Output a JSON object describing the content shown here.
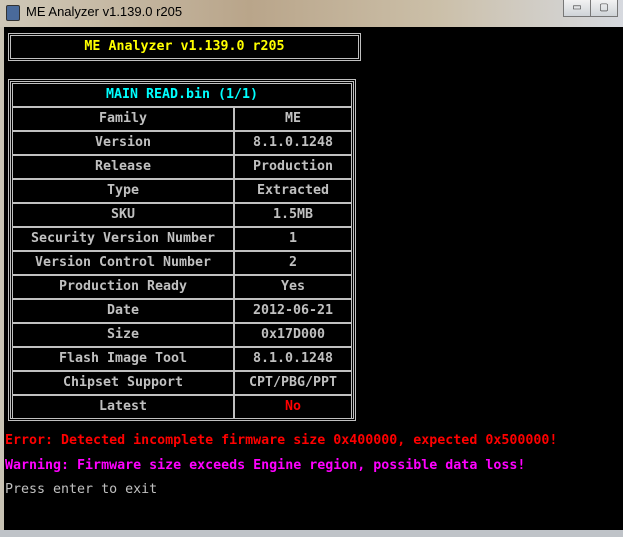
{
  "window": {
    "title": "ME Analyzer v1.139.0 r205",
    "minimize": "▭",
    "maximize": "▢"
  },
  "banner": "ME Analyzer v1.139.0 r205",
  "table": {
    "header": "MAIN  READ.bin (1/1)",
    "rows": [
      {
        "label": "Family",
        "value": "ME"
      },
      {
        "label": "Version",
        "value": "8.1.0.1248"
      },
      {
        "label": "Release",
        "value": "Production"
      },
      {
        "label": "Type",
        "value": "Extracted"
      },
      {
        "label": "SKU",
        "value": "1.5MB"
      },
      {
        "label": "Security Version Number",
        "value": "1"
      },
      {
        "label": "Version Control Number",
        "value": "2"
      },
      {
        "label": "Production Ready",
        "value": "Yes"
      },
      {
        "label": "Date",
        "value": "2012-06-21"
      },
      {
        "label": "Size",
        "value": "0x17D000"
      },
      {
        "label": "Flash Image Tool",
        "value": "8.1.0.1248"
      },
      {
        "label": "Chipset Support",
        "value": "CPT/PBG/PPT"
      },
      {
        "label": "Latest",
        "value": "No"
      }
    ]
  },
  "messages": {
    "error": "Error: Detected incomplete firmware size 0x400000, expected 0x500000!",
    "warning": "Warning: Firmware size exceeds Engine region, possible data loss!",
    "prompt": "Press enter to exit"
  },
  "colors": {
    "banner": "#ffff00",
    "header": "#00ffff",
    "error": "#ff0000",
    "warning": "#ff00ff",
    "text": "#c0c0c0"
  }
}
